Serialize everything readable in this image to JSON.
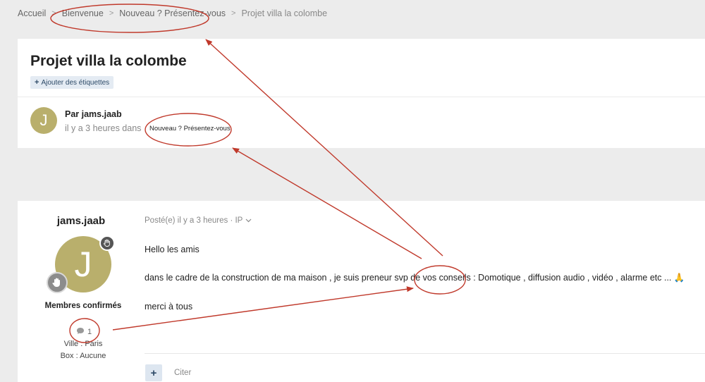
{
  "breadcrumb": {
    "items": [
      "Accueil",
      "Bienvenue",
      "Nouveau ? Présentez-vous",
      "Projet villa la colombe"
    ],
    "separator": ">"
  },
  "topic": {
    "title": "Projet villa la colombe",
    "add_tags": "Ajouter des étiquettes",
    "author_initial": "J",
    "author_by": "Par jams.jaab",
    "author_time": "il y a 3 heures dans",
    "forum": "Nouveau ? Présentez-vous"
  },
  "post": {
    "poster_name": "jams.jaab",
    "avatar_initial": "J",
    "group": "Membres confirmés",
    "post_count": "1",
    "ville": "Ville : Paris",
    "box": "Box : Aucune",
    "meta": "Posté(e) il y a 3 heures · IP",
    "lines": [
      "Hello les amis",
      "dans le cadre de la construction de ma maison , je suis preneur svp de vos conseils : Domotique , diffusion audio , vidéo , alarme etc ... 🙏",
      "merci  à tous"
    ],
    "quote_label": "Citer"
  },
  "annotation_color": "#c0392b"
}
